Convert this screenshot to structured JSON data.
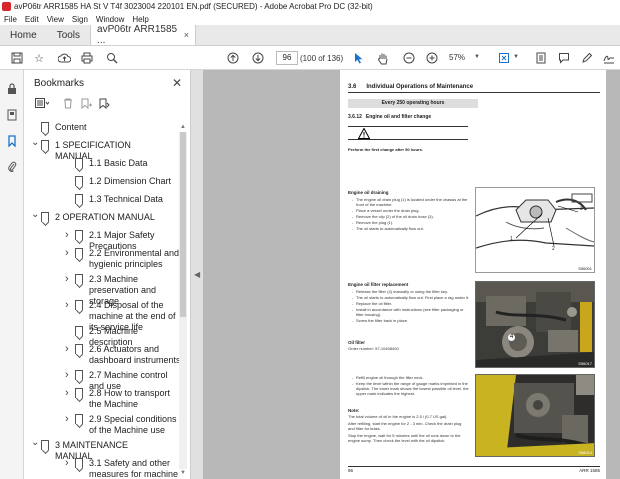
{
  "window": {
    "title": "avP06tr ARR1585 HA St V T4f 3023004 220101 EN.pdf (SECURED) - Adobe Acrobat Pro DC (32-bit)"
  },
  "menu": [
    "File",
    "Edit",
    "View",
    "Sign",
    "Window",
    "Help"
  ],
  "tabs": {
    "home": "Home",
    "tools": "Tools",
    "doc": "avP06tr ARR1585 ...",
    "close": "×"
  },
  "toolbar": {
    "page_current": "96",
    "page_count": "(100 of 136)",
    "zoom": "57%"
  },
  "bookmarks": {
    "title": "Bookmarks",
    "items": [
      {
        "label": "Content",
        "level": 0,
        "chev": ""
      },
      {
        "label": "1 SPECIFICATION MANUAL",
        "level": 0,
        "chev": "v"
      },
      {
        "label": "1.1 Basic Data",
        "level": 1,
        "chev": ""
      },
      {
        "label": "1.2 Dimension Chart",
        "level": 1,
        "chev": ""
      },
      {
        "label": "1.3 Technical Data",
        "level": 1,
        "chev": ""
      },
      {
        "label": "2 OPERATION MANUAL",
        "level": 0,
        "chev": "v"
      },
      {
        "label": "2.1 Major Safety Precautions",
        "level": 1,
        "chev": ">"
      },
      {
        "label": "2.2 Environmental and hygienic principles",
        "level": 1,
        "chev": ">"
      },
      {
        "label": "2.3 Machine preservation and storage",
        "level": 1,
        "chev": ">"
      },
      {
        "label": "2.4 Disposal of the machine at the end of its service life",
        "level": 1,
        "chev": ">"
      },
      {
        "label": "2.5 Machine description",
        "level": 1,
        "chev": ""
      },
      {
        "label": "2.6 Actuators and dashboard instruments",
        "level": 1,
        "chev": ">"
      },
      {
        "label": "2.7 Machine control and use",
        "level": 1,
        "chev": ">"
      },
      {
        "label": "2.8 How to transport the Machine",
        "level": 1,
        "chev": ">"
      },
      {
        "label": "2.9 Special conditions of the Machine use",
        "level": 1,
        "chev": ">"
      },
      {
        "label": "3 MAINTENANCE MANUAL",
        "level": 0,
        "chev": "v"
      },
      {
        "label": "3.1 Safety and other measures for machine maintenance",
        "level": 1,
        "chev": ">"
      }
    ]
  },
  "pdf": {
    "heading_num": "3.6",
    "heading": "Individual Operations of Maintenance",
    "every": "Every 250 operating hours",
    "sub_num": "3.6.12",
    "sub": "Engine oil and filter change",
    "first_change": "Perform the first change after 50 hours.",
    "drain_title": "Engine oil draining",
    "drain_bullets": [
      "The engine oil drain plug (1) is located under the chassis at the front of the machine.",
      "Place a vessel under the drain plug.",
      "Remove the clip (2) of the oil drain hose (3).",
      "Remove the plug (1).",
      "The oil starts to automatically flow out."
    ],
    "fig1": "S56001",
    "fig1_labels": [
      "1",
      "2",
      "3"
    ],
    "filter_title": "Engine oil filter replacement",
    "filter_bullets": [
      "Release the filter (4) manually or using the filter key.",
      "The oil starts to automatically flow out. First place a rag under it.",
      "Replace the oil filter.",
      "Install in accordance with instructions (see filter packaging or filter housing).",
      "Screw the filter back in place."
    ],
    "fig2": "S56017",
    "fig2_label": "4",
    "oil_filter_title": "Oil filter",
    "oil_filter_order": "Order number: 57-10408400",
    "refill_bullets": [
      "Refill engine oil through the filler neck.",
      "Keep the level within the range of gauge marks imprinted in the dipstick. The lower mark shows the lowest possible oil level, the upper mark indicates the highest."
    ],
    "fig3": "S56014",
    "note_title": "Note:",
    "note_lines": [
      "The total volume of oil in the engine is 2.5 l (0.7 US gal).",
      "After refilling, start the engine for 2 - 3 min. Check the drain plug and filter for leaks.",
      "Stop the engine, wait for 5 minutes until the oil runs down to the engine sump. Then check the level with the oil dipstick."
    ],
    "footer_page": "96",
    "footer_model": "ARR 1585"
  }
}
